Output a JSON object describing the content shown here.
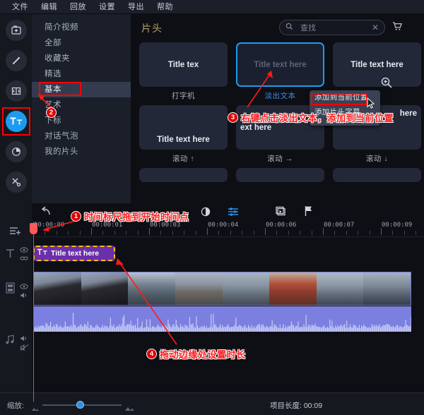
{
  "menubar": {
    "items": [
      {
        "label": "文件"
      },
      {
        "label": "编辑"
      },
      {
        "label": "回放"
      },
      {
        "label": "设置"
      },
      {
        "label": "导出"
      },
      {
        "label": "帮助"
      }
    ]
  },
  "rail": {
    "items": [
      {
        "name": "media-import",
        "icon": "folder-plus-icon",
        "active": false
      },
      {
        "name": "effects",
        "icon": "magic-wand-icon",
        "active": false
      },
      {
        "name": "transitions",
        "icon": "transition-icon",
        "active": false
      },
      {
        "name": "titles",
        "icon": "title-text-icon",
        "active": true
      },
      {
        "name": "filters",
        "icon": "pie-icon",
        "active": false
      },
      {
        "name": "tools",
        "icon": "tools-icon",
        "active": false
      }
    ]
  },
  "categories": {
    "items": [
      {
        "label": "简介视频",
        "selected": false
      },
      {
        "label": "全部",
        "selected": false
      },
      {
        "label": "收藏夹",
        "selected": false
      },
      {
        "label": "精选",
        "selected": false
      },
      {
        "label": "基本",
        "selected": true
      },
      {
        "label": "艺术",
        "selected": false
      },
      {
        "label": "下标",
        "selected": false
      },
      {
        "label": "对话气泡",
        "selected": false
      },
      {
        "label": "我的片头",
        "selected": false
      }
    ]
  },
  "panel": {
    "title": "片头",
    "search": {
      "placeholder": "查找",
      "icon": "search-icon",
      "clear_icon": "close-icon"
    },
    "cart_icon": "cart-icon",
    "zoom_icon": "zoom-in-icon",
    "templates": [
      {
        "thumb_text": "Title tex",
        "caption": "打字机",
        "selected": false,
        "dim": false,
        "align": "center"
      },
      {
        "thumb_text": "Title text here",
        "caption": "淡出文本",
        "selected": true,
        "dim": true,
        "align": "center"
      },
      {
        "thumb_text": "Title text here",
        "caption": "",
        "selected": false,
        "dim": false,
        "align": "center"
      },
      {
        "thumb_text": "Title text here",
        "caption": "滚动 ↑",
        "selected": false,
        "dim": false,
        "align": "bottom"
      },
      {
        "thumb_text": "ext here",
        "caption": "滚动 →",
        "selected": false,
        "dim": false,
        "align": "left"
      },
      {
        "thumb_text": "here",
        "caption": "滚动 ↓",
        "selected": false,
        "dim": false,
        "align": "center"
      }
    ]
  },
  "context_menu": {
    "items": [
      {
        "label": "添加到当前位置",
        "highlighted": true
      },
      {
        "label": "添加片头字幕",
        "highlighted": false
      }
    ]
  },
  "timeline": {
    "toolbar_icons": [
      "undo-icon",
      "redo-icon",
      "split-icon",
      "crop-icon",
      "speed-icon",
      "delete-icon",
      "color-icon",
      "adjust-icon",
      "snapshot-icon",
      "marker-icon"
    ],
    "ruler_labels": [
      "00:00:00",
      "00:00:01",
      "00:00:03",
      "00:00:04",
      "00:00:06",
      "00:00:07",
      "00:00:09"
    ],
    "tracks": [
      {
        "name": "text-track",
        "icon": "T",
        "eye_icon": "eye-icon",
        "lock_icon": "link-icon"
      },
      {
        "name": "video-track",
        "icon": "film-icon",
        "eye_icon": "eye-icon",
        "audio_icon": "speaker-icon"
      },
      {
        "name": "audio-track",
        "icon": "music-icon",
        "audio_icon": "speaker-icon",
        "mute_icon": "speaker-muted-icon"
      }
    ],
    "title_clip": {
      "label": "Title text here",
      "icon": "title-text-icon"
    }
  },
  "bottom": {
    "zoom_label": "缩放:",
    "zoom_out_icon": "mountain-small-icon",
    "zoom_in_icon": "mountain-large-icon",
    "project_length": "项目长度: 00:09"
  },
  "annotations": [
    {
      "num": "1",
      "text": "时间标尺拖到开始时间点"
    },
    {
      "num": "2",
      "text": ""
    },
    {
      "num": "3",
      "text": "右键点击淡出文本，添加到当前位置"
    },
    {
      "num": "4",
      "text": "拖动边缘处设置时长"
    }
  ]
}
